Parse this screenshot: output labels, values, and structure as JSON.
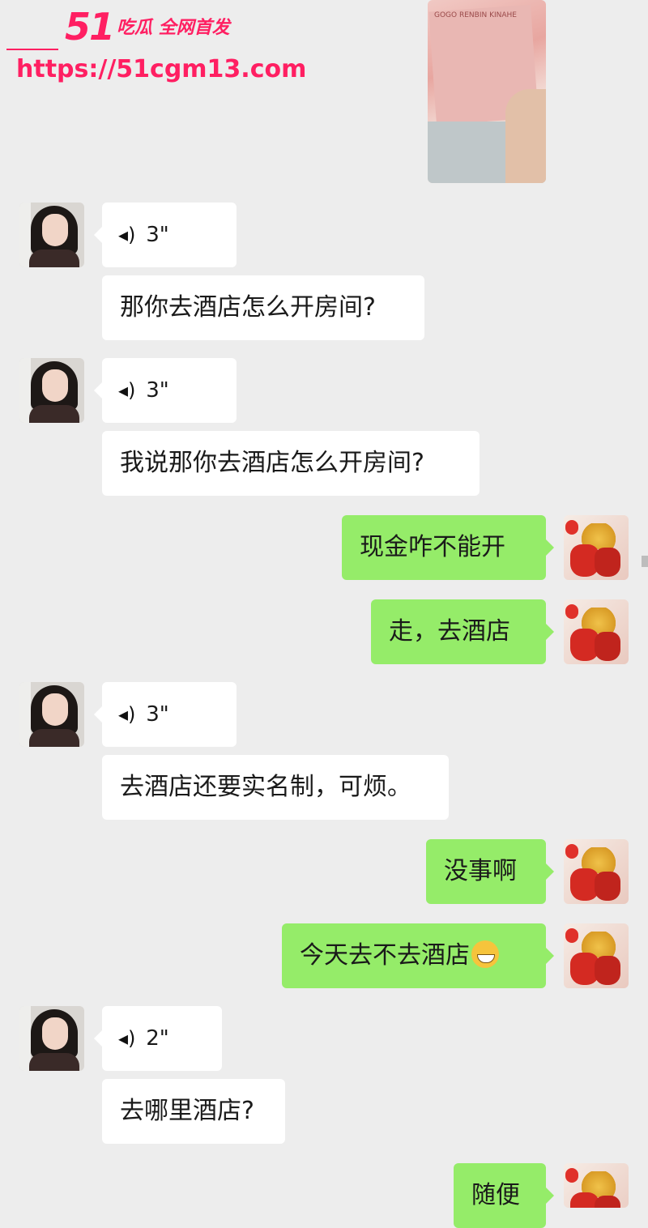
{
  "watermark": {
    "logo_number": "51",
    "logo_tag": "吃瓜 全网首发",
    "url": "https://51cgm13.com"
  },
  "photo": {
    "bill_text": "GOGO RENBIN KINAHE"
  },
  "messages": [
    {
      "side": "in",
      "type": "voice",
      "duration": "3\""
    },
    {
      "side": "in",
      "type": "text",
      "text": "那你去酒店怎么开房间?"
    },
    {
      "side": "in",
      "type": "voice",
      "duration": "3\""
    },
    {
      "side": "in",
      "type": "text",
      "text": "我说那你去酒店怎么开房间?"
    },
    {
      "side": "out",
      "type": "text",
      "text": "现金咋不能开"
    },
    {
      "side": "out",
      "type": "text",
      "text": "走，去酒店"
    },
    {
      "side": "in",
      "type": "voice",
      "duration": "3\""
    },
    {
      "side": "in",
      "type": "text",
      "text": "去酒店还要实名制，可烦。"
    },
    {
      "side": "out",
      "type": "text",
      "text": "没事啊"
    },
    {
      "side": "out",
      "type": "text",
      "text": "今天去不去酒店",
      "emoji": "grinning-face-emoji"
    },
    {
      "side": "in",
      "type": "voice",
      "duration": "2\""
    },
    {
      "side": "in",
      "type": "text",
      "text": "去哪里酒店?"
    },
    {
      "side": "out",
      "type": "text",
      "text": "随便"
    }
  ],
  "icons": {
    "voice": "voice-wave-icon",
    "contact_avatar": "woman-portrait",
    "self_avatar": "red-lucky-bags-wheat"
  },
  "colors": {
    "background": "#ededed",
    "incoming_bubble": "#ffffff",
    "outgoing_bubble": "#95ec69",
    "watermark": "#ff1f62"
  }
}
